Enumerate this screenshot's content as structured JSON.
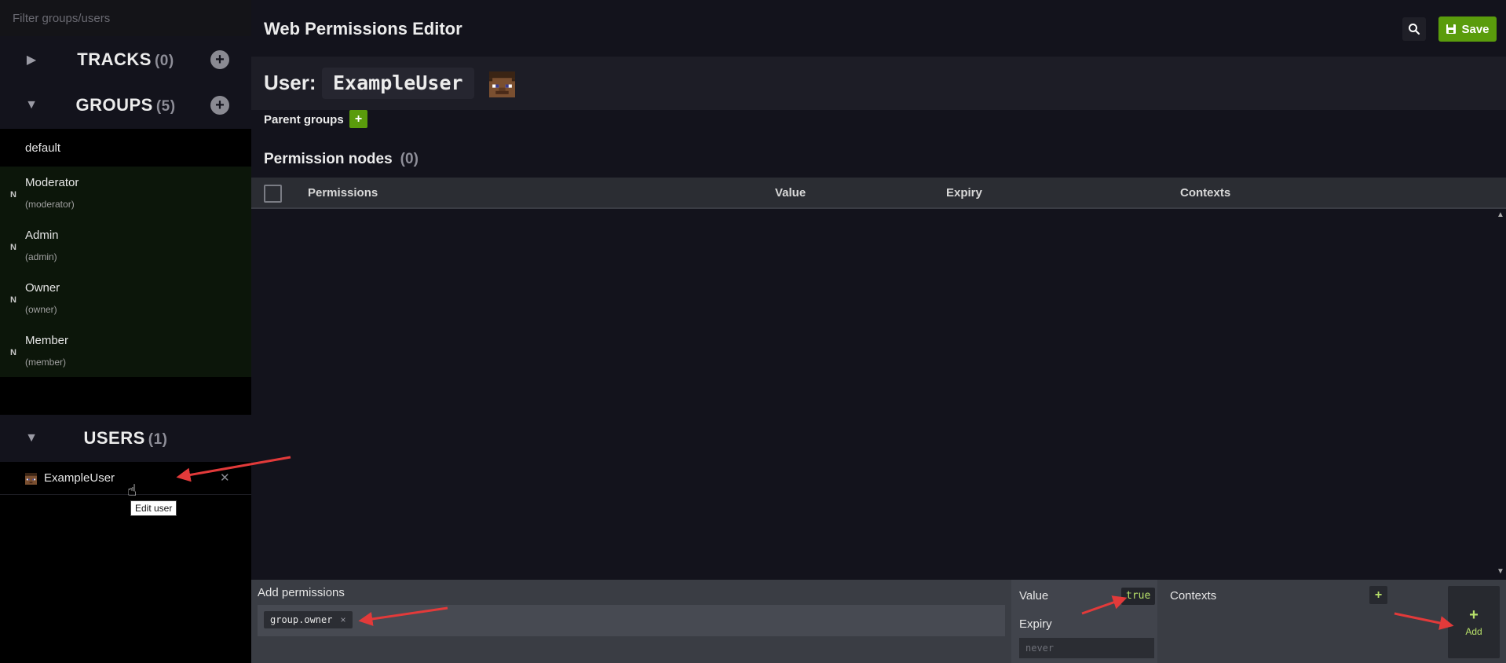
{
  "sidebar": {
    "filter_placeholder": "Filter groups/users",
    "tracks": {
      "title": "TRACKS",
      "count": "(0)"
    },
    "groups": {
      "title": "GROUPS",
      "count": "(5)"
    },
    "users": {
      "title": "USERS",
      "count": "(1)"
    },
    "default_group": "default",
    "group_items": [
      {
        "name": "Moderator",
        "id": "(moderator)",
        "badge": "N"
      },
      {
        "name": "Admin",
        "id": "(admin)",
        "badge": "N"
      },
      {
        "name": "Owner",
        "id": "(owner)",
        "badge": "N"
      },
      {
        "name": "Member",
        "id": "(member)",
        "badge": "N"
      }
    ],
    "user_items": [
      {
        "name": "ExampleUser",
        "remove": "✕"
      }
    ],
    "tooltip": "Edit user"
  },
  "header": {
    "title": "Web Permissions Editor",
    "save_label": "Save"
  },
  "user_header": {
    "label": "User:",
    "username": "ExampleUser"
  },
  "parent_groups": {
    "label": "Parent groups",
    "add": "+"
  },
  "permission_nodes": {
    "title": "Permission nodes",
    "count": "(0)",
    "columns": [
      "Permissions",
      "Value",
      "Expiry",
      "Contexts"
    ]
  },
  "add_panel": {
    "label": "Add permissions",
    "chip_text": "group.owner",
    "chip_remove": "×",
    "value_label": "Value",
    "value": "true",
    "expiry_label": "Expiry",
    "expiry_placeholder": "never",
    "contexts_label": "Contexts",
    "contexts_add": "+",
    "add_plus": "+",
    "add_label": "Add"
  },
  "colors": {
    "accent_green": "#5a9c0c",
    "value_green": "#b7e06a",
    "annotation_red": "#e23a3a"
  }
}
